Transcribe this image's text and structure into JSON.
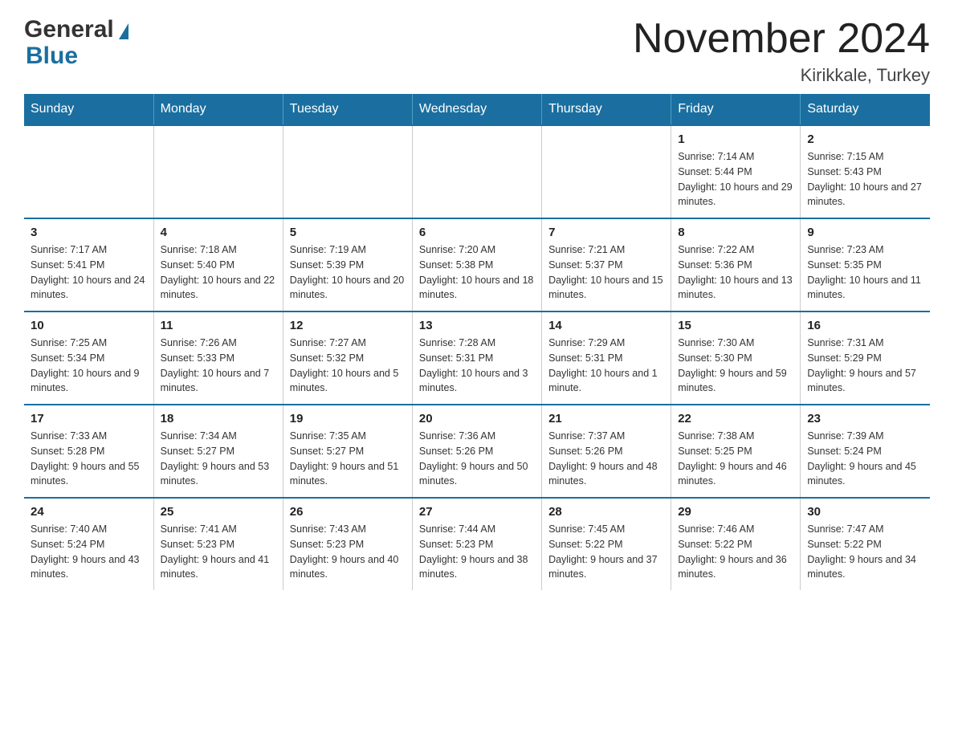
{
  "logo": {
    "general": "General",
    "blue": "Blue"
  },
  "title": "November 2024",
  "location": "Kirikkale, Turkey",
  "days_of_week": [
    "Sunday",
    "Monday",
    "Tuesday",
    "Wednesday",
    "Thursday",
    "Friday",
    "Saturday"
  ],
  "weeks": [
    [
      {
        "day": "",
        "info": ""
      },
      {
        "day": "",
        "info": ""
      },
      {
        "day": "",
        "info": ""
      },
      {
        "day": "",
        "info": ""
      },
      {
        "day": "",
        "info": ""
      },
      {
        "day": "1",
        "info": "Sunrise: 7:14 AM\nSunset: 5:44 PM\nDaylight: 10 hours and 29 minutes."
      },
      {
        "day": "2",
        "info": "Sunrise: 7:15 AM\nSunset: 5:43 PM\nDaylight: 10 hours and 27 minutes."
      }
    ],
    [
      {
        "day": "3",
        "info": "Sunrise: 7:17 AM\nSunset: 5:41 PM\nDaylight: 10 hours and 24 minutes."
      },
      {
        "day": "4",
        "info": "Sunrise: 7:18 AM\nSunset: 5:40 PM\nDaylight: 10 hours and 22 minutes."
      },
      {
        "day": "5",
        "info": "Sunrise: 7:19 AM\nSunset: 5:39 PM\nDaylight: 10 hours and 20 minutes."
      },
      {
        "day": "6",
        "info": "Sunrise: 7:20 AM\nSunset: 5:38 PM\nDaylight: 10 hours and 18 minutes."
      },
      {
        "day": "7",
        "info": "Sunrise: 7:21 AM\nSunset: 5:37 PM\nDaylight: 10 hours and 15 minutes."
      },
      {
        "day": "8",
        "info": "Sunrise: 7:22 AM\nSunset: 5:36 PM\nDaylight: 10 hours and 13 minutes."
      },
      {
        "day": "9",
        "info": "Sunrise: 7:23 AM\nSunset: 5:35 PM\nDaylight: 10 hours and 11 minutes."
      }
    ],
    [
      {
        "day": "10",
        "info": "Sunrise: 7:25 AM\nSunset: 5:34 PM\nDaylight: 10 hours and 9 minutes."
      },
      {
        "day": "11",
        "info": "Sunrise: 7:26 AM\nSunset: 5:33 PM\nDaylight: 10 hours and 7 minutes."
      },
      {
        "day": "12",
        "info": "Sunrise: 7:27 AM\nSunset: 5:32 PM\nDaylight: 10 hours and 5 minutes."
      },
      {
        "day": "13",
        "info": "Sunrise: 7:28 AM\nSunset: 5:31 PM\nDaylight: 10 hours and 3 minutes."
      },
      {
        "day": "14",
        "info": "Sunrise: 7:29 AM\nSunset: 5:31 PM\nDaylight: 10 hours and 1 minute."
      },
      {
        "day": "15",
        "info": "Sunrise: 7:30 AM\nSunset: 5:30 PM\nDaylight: 9 hours and 59 minutes."
      },
      {
        "day": "16",
        "info": "Sunrise: 7:31 AM\nSunset: 5:29 PM\nDaylight: 9 hours and 57 minutes."
      }
    ],
    [
      {
        "day": "17",
        "info": "Sunrise: 7:33 AM\nSunset: 5:28 PM\nDaylight: 9 hours and 55 minutes."
      },
      {
        "day": "18",
        "info": "Sunrise: 7:34 AM\nSunset: 5:27 PM\nDaylight: 9 hours and 53 minutes."
      },
      {
        "day": "19",
        "info": "Sunrise: 7:35 AM\nSunset: 5:27 PM\nDaylight: 9 hours and 51 minutes."
      },
      {
        "day": "20",
        "info": "Sunrise: 7:36 AM\nSunset: 5:26 PM\nDaylight: 9 hours and 50 minutes."
      },
      {
        "day": "21",
        "info": "Sunrise: 7:37 AM\nSunset: 5:26 PM\nDaylight: 9 hours and 48 minutes."
      },
      {
        "day": "22",
        "info": "Sunrise: 7:38 AM\nSunset: 5:25 PM\nDaylight: 9 hours and 46 minutes."
      },
      {
        "day": "23",
        "info": "Sunrise: 7:39 AM\nSunset: 5:24 PM\nDaylight: 9 hours and 45 minutes."
      }
    ],
    [
      {
        "day": "24",
        "info": "Sunrise: 7:40 AM\nSunset: 5:24 PM\nDaylight: 9 hours and 43 minutes."
      },
      {
        "day": "25",
        "info": "Sunrise: 7:41 AM\nSunset: 5:23 PM\nDaylight: 9 hours and 41 minutes."
      },
      {
        "day": "26",
        "info": "Sunrise: 7:43 AM\nSunset: 5:23 PM\nDaylight: 9 hours and 40 minutes."
      },
      {
        "day": "27",
        "info": "Sunrise: 7:44 AM\nSunset: 5:23 PM\nDaylight: 9 hours and 38 minutes."
      },
      {
        "day": "28",
        "info": "Sunrise: 7:45 AM\nSunset: 5:22 PM\nDaylight: 9 hours and 37 minutes."
      },
      {
        "day": "29",
        "info": "Sunrise: 7:46 AM\nSunset: 5:22 PM\nDaylight: 9 hours and 36 minutes."
      },
      {
        "day": "30",
        "info": "Sunrise: 7:47 AM\nSunset: 5:22 PM\nDaylight: 9 hours and 34 minutes."
      }
    ]
  ]
}
